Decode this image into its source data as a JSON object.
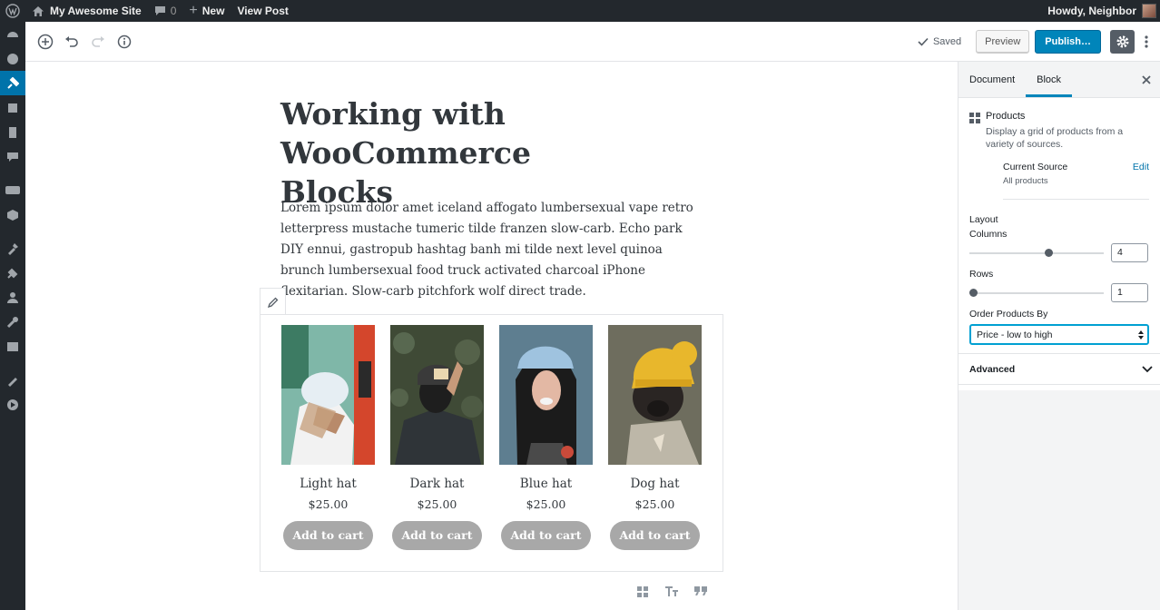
{
  "adminbar": {
    "site_name": "My Awesome Site",
    "comments_count": "0",
    "new_label": "New",
    "view_post_label": "View Post",
    "howdy": "Howdy, Neighbor"
  },
  "header": {
    "saved_label": "Saved",
    "preview_label": "Preview",
    "publish_label": "Publish…"
  },
  "post": {
    "title_line1": "Working with WooCommerce",
    "title_line2": "Blocks",
    "paragraph": "Lorem ipsum dolor amet iceland affogato lumbersexual vape retro letterpress mustache tumeric tilde franzen slow-carb. Echo park DIY ennui, gastropub hashtag banh mi tilde next level quinoa brunch lumbersexual food truck activated charcoal iPhone flexitarian. Slow-carb pitchfork wolf direct trade."
  },
  "products": [
    {
      "name": "Light hat",
      "price": "$25.00",
      "cart_label": "Add to cart"
    },
    {
      "name": "Dark hat",
      "price": "$25.00",
      "cart_label": "Add to cart"
    },
    {
      "name": "Blue hat",
      "price": "$25.00",
      "cart_label": "Add to cart"
    },
    {
      "name": "Dog hat",
      "price": "$25.00",
      "cart_label": "Add to cart"
    }
  ],
  "sidebar": {
    "tab_document": "Document",
    "tab_block": "Block",
    "block_name": "Products",
    "block_desc": "Display a grid of products from a variety of sources.",
    "current_source_label": "Current Source",
    "edit_label": "Edit",
    "current_source_value": "All products",
    "layout_label": "Layout",
    "columns_label": "Columns",
    "columns_value": "4",
    "rows_label": "Rows",
    "rows_value": "1",
    "columns_slider_fraction": 0.6,
    "rows_slider_fraction": 0.0,
    "order_label": "Order Products By",
    "order_value": "Price - low to high",
    "advanced_label": "Advanced"
  },
  "colors": {
    "admin_bg": "#23282d",
    "accent": "#0085ba",
    "button_gray": "#a8a8a8"
  }
}
